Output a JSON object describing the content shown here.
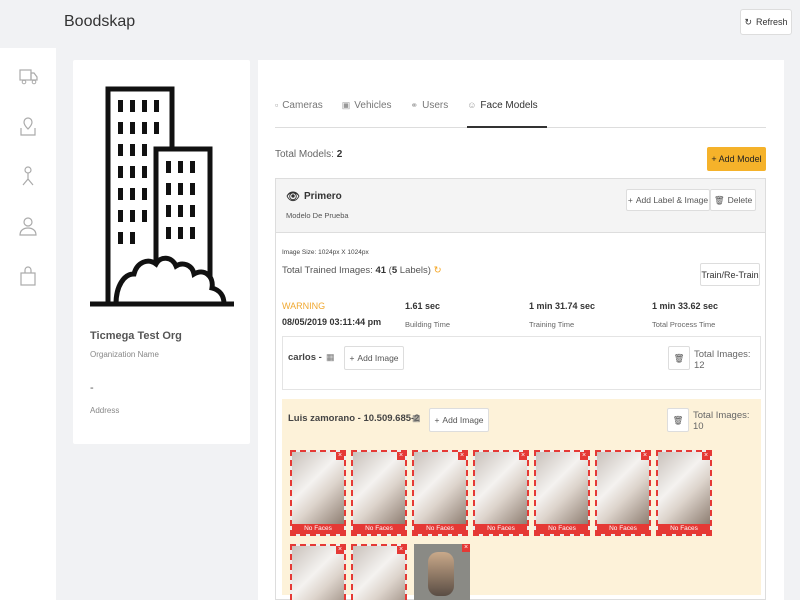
{
  "app": {
    "brand": "Boodskap",
    "refresh_label": "Refresh"
  },
  "sidebar": {
    "items": [
      "truck-icon",
      "map-pin-icon",
      "person-icon",
      "users-icon",
      "bag-icon"
    ]
  },
  "org": {
    "name": "Ticmega Test Org",
    "name_label": "Organization Name",
    "address": "-",
    "address_label": "Address"
  },
  "tabs": [
    {
      "label": "Cameras",
      "icon": "camera-icon"
    },
    {
      "label": "Vehicles",
      "icon": "car-icon"
    },
    {
      "label": "Users",
      "icon": "users-icon"
    },
    {
      "label": "Face Models",
      "icon": "face-icon"
    }
  ],
  "total_models": {
    "label": "Total Models:",
    "value": "2"
  },
  "add_model_label": "Add Model",
  "model": {
    "name": "Primero",
    "subtitle": "Modelo De Prueba",
    "add_label_image": "Add Label & Image",
    "delete_label": "Delete",
    "image_size": "Image Size: 1024px X 1024px",
    "trained_prefix": "Total Trained Images:",
    "trained_count": "41",
    "trained_labels_count": "5",
    "trained_labels_word": "Labels",
    "train_button": "Train/Re-Train",
    "status": "WARNING",
    "status_time": "08/05/2019 03:11:44 pm",
    "building_time": "1.61 sec",
    "building_label": "Building Time",
    "training_time": "1 min 31.74 sec",
    "training_label": "Training Time",
    "total_time": "1 min 33.62 sec",
    "total_label": "Total Process Time",
    "labels": [
      {
        "name": "carlos -",
        "add_image": "Add Image",
        "total_images": "Total Images: 12"
      },
      {
        "name": "Luis zamorano - 10.509.685-2",
        "add_image": "Add Image",
        "total_images": "Total Images: 10"
      }
    ],
    "thumb_caption": "No Faces"
  },
  "colors": {
    "accent": "#f5b22a",
    "warning": "#f0a830",
    "error": "#e53935",
    "highlight": "#fdf2d9"
  }
}
